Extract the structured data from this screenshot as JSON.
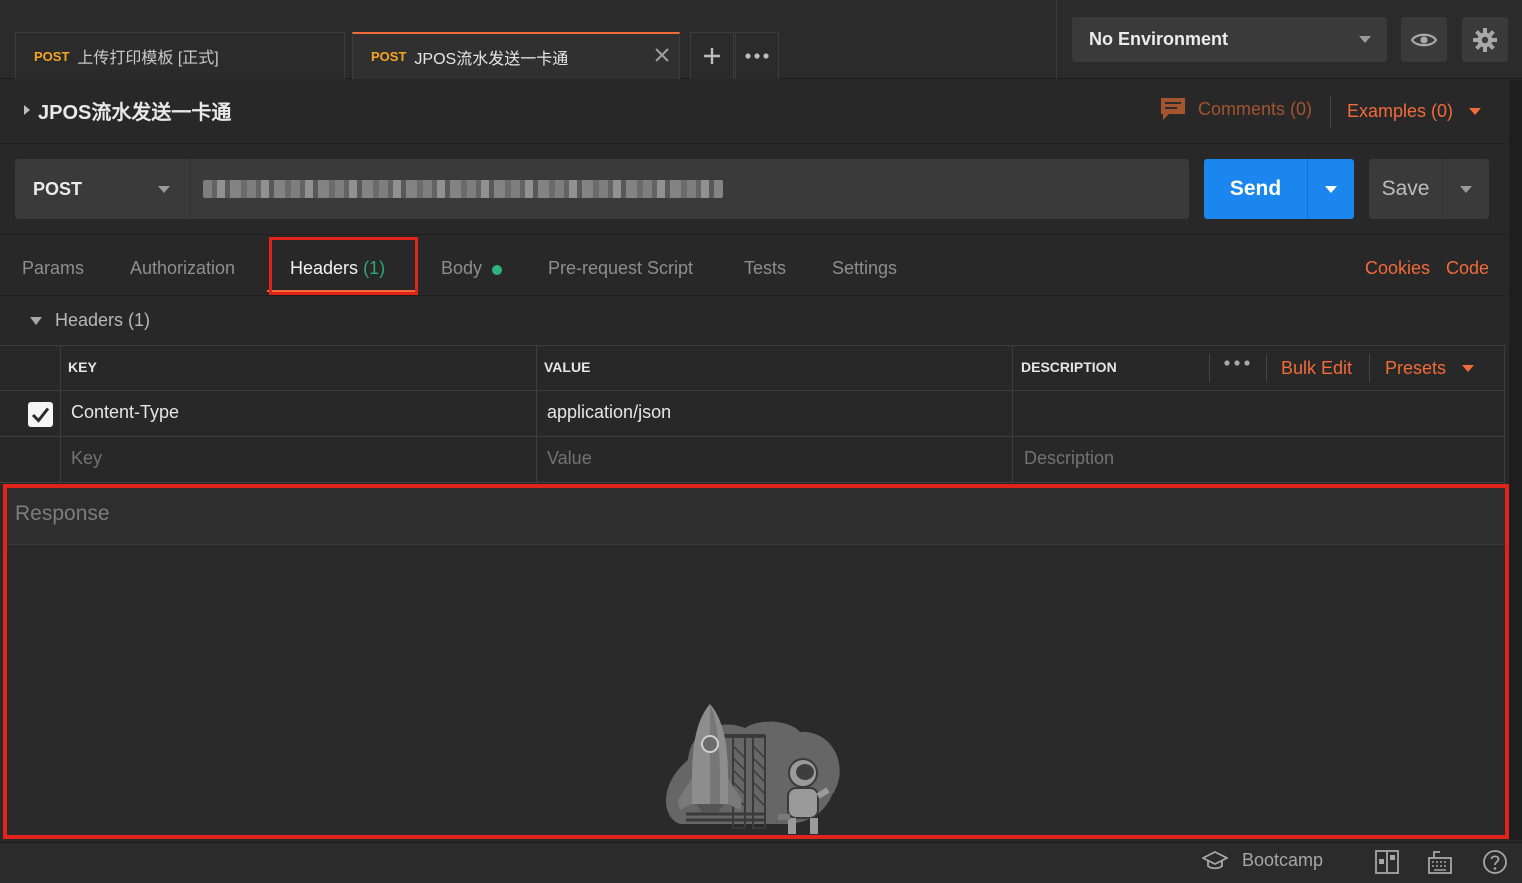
{
  "tabs": [
    {
      "method": "POST",
      "name": "上传打印模板 [正式]"
    },
    {
      "method": "POST",
      "name": "JPOS流水发送一卡通"
    }
  ],
  "environment": {
    "selected": "No Environment"
  },
  "request": {
    "title": "JPOS流水发送一卡通",
    "comments_label": "Comments (0)",
    "examples_label": "Examples (0)",
    "method": "POST",
    "send_label": "Send",
    "save_label": "Save"
  },
  "request_tabs": {
    "params": "Params",
    "authorization": "Authorization",
    "headers": "Headers",
    "headers_count": "(1)",
    "body": "Body",
    "pre_request": "Pre-request Script",
    "tests": "Tests",
    "settings": "Settings",
    "cookies": "Cookies",
    "code": "Code"
  },
  "headers_section": {
    "title": "Headers (1)",
    "columns": {
      "key": "KEY",
      "value": "VALUE",
      "description": "DESCRIPTION"
    },
    "bulk_edit": "Bulk Edit",
    "presets": "Presets",
    "rows": [
      {
        "checked": true,
        "key": "Content-Type",
        "value": "application/json",
        "description": ""
      }
    ],
    "placeholders": {
      "key": "Key",
      "value": "Value",
      "description": "Description"
    }
  },
  "response": {
    "title": "Response"
  },
  "status_bar": {
    "bootcamp": "Bootcamp"
  },
  "colors": {
    "accent": "#f26b3a",
    "send_blue": "#1a86ee",
    "highlight_red": "#e0231b",
    "count_green": "#2fa67a"
  }
}
